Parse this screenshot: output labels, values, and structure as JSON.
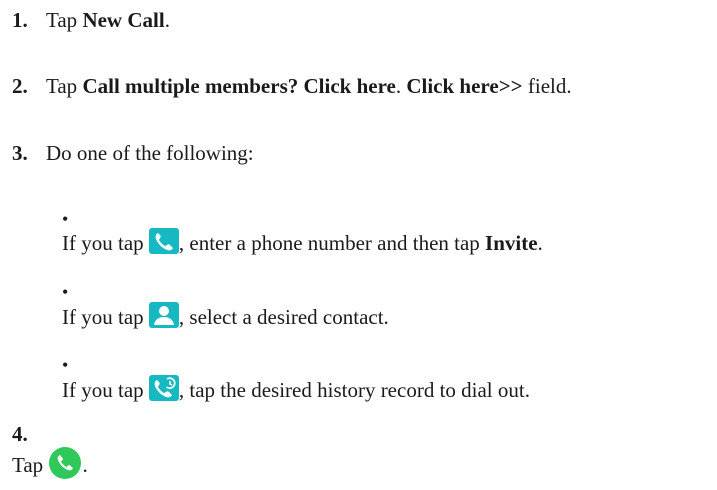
{
  "steps": {
    "s1": {
      "num": "1.",
      "pre": "Tap ",
      "bold": "New Call",
      "post": "."
    },
    "s2": {
      "num": "2.",
      "pre": "Tap ",
      "bold1": "Call multiple members? Click here",
      "mid": ". ",
      "bold2": "Click here>>",
      "post": " field."
    },
    "s3": {
      "num": "3.",
      "text": "Do one of the following:"
    },
    "s4": {
      "num": "4.",
      "pre": "Tap ",
      "post": "."
    }
  },
  "bullets": {
    "b1": {
      "dot": "•",
      "pre": "If you tap ",
      "mid": ", enter a phone number and then tap ",
      "bold": "Invite",
      "post": ".",
      "icon": "phone-dial-icon"
    },
    "b2": {
      "dot": "•",
      "pre": "If you tap ",
      "post": ", select a desired contact.",
      "icon": "contact-icon"
    },
    "b3": {
      "dot": "•",
      "pre": "If you tap ",
      "post": ", tap the desired history record to dial out.",
      "icon": "call-history-icon"
    }
  },
  "colors": {
    "icon_teal": "#16b8c2",
    "call_green": "#2fc85a",
    "text": "#1a1a1a"
  }
}
